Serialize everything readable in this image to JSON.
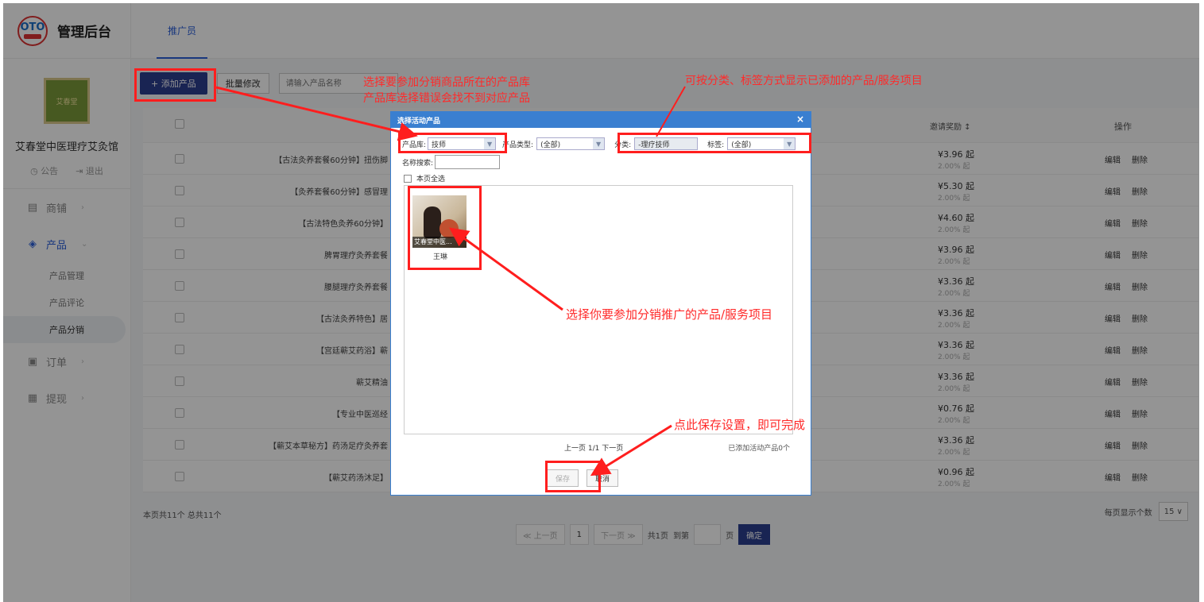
{
  "app": {
    "brand_badge": "OTO",
    "title": "管理后台"
  },
  "sidebar": {
    "shop_logo_text": "艾春堂",
    "shop_name": "艾春堂中医理疗艾灸馆",
    "links": [
      "公告",
      "退出"
    ],
    "nav": [
      {
        "label": "商铺",
        "icon": "shop-icon"
      },
      {
        "label": "产品",
        "icon": "layers-icon"
      },
      {
        "label": "订单",
        "icon": "order-icon"
      },
      {
        "label": "提现",
        "icon": "wallet-icon"
      }
    ],
    "sub": [
      "产品管理",
      "产品评论",
      "产品分销"
    ]
  },
  "tabs": [
    "推广员"
  ],
  "toolbar": {
    "add": "+ 添加产品",
    "batch": "批量修改",
    "search_placeholder": "请输入产品名称"
  },
  "table": {
    "headers": {
      "reward": "邀请奖励 ↕",
      "ops": "操作"
    },
    "rows": [
      {
        "name": "【古法灸养套餐60分钟】扭伤脚",
        "reward": "¥3.96 起",
        "pct": "2.00% 起"
      },
      {
        "name": "【灸养套餐60分钟】感冒理",
        "reward": "¥5.30 起",
        "pct": "2.00% 起"
      },
      {
        "name": "【古法特色灸养60分钟】",
        "reward": "¥4.60 起",
        "pct": "2.00% 起"
      },
      {
        "name": "脾胃理疗灸养套餐",
        "reward": "¥3.96 起",
        "pct": "2.00% 起"
      },
      {
        "name": "腰腿理疗灸养套餐",
        "reward": "¥3.36 起",
        "pct": "2.00% 起"
      },
      {
        "name": "【古法灸养特色】居",
        "reward": "¥3.36 起",
        "pct": "2.00% 起"
      },
      {
        "name": "【宫廷蕲艾药浴】蕲",
        "reward": "¥3.36 起",
        "pct": "2.00% 起"
      },
      {
        "name": "蕲艾精油",
        "reward": "¥3.36 起",
        "pct": "2.00% 起"
      },
      {
        "name": "【专业中医巡经",
        "reward": "¥0.76 起",
        "pct": "2.00% 起"
      },
      {
        "name": "【蕲艾本草秘方】药汤足疗灸养套",
        "reward": "¥3.36 起",
        "pct": "2.00% 起"
      },
      {
        "name": "【蕲艾药汤沐足】",
        "reward": "¥0.96 起",
        "pct": "2.00% 起"
      }
    ],
    "op_edit": "编辑",
    "op_delete": "删除"
  },
  "footer": {
    "summary": "本页共11个  总共11个",
    "per_page_label": "每页显示个数",
    "per_page": "15 ∨",
    "prev": "≪ 上一页",
    "page": "1",
    "next": "下一页 ≫",
    "total_pages": "共1页",
    "goto": "到第",
    "page_unit": "页",
    "ok": "确定"
  },
  "modal": {
    "title": "选择活动产品",
    "close": "×",
    "lib_label": "产品库:",
    "lib_value": "技师",
    "type_label": "产品类型:",
    "type_value": "(全部)",
    "cat_label": "分类:",
    "cat_value": "-理疗技师",
    "tag_label": "标签:",
    "tag_value": "(全部)",
    "name_search_label": "名称搜索:",
    "select_all": "本页全选",
    "card": {
      "caption": "艾春堂中医...",
      "name": "王琳"
    },
    "pager": "上一页 1/1 下一页",
    "added": "已添加活动产品0个",
    "save": "保存",
    "cancel": "取消"
  },
  "annotations": {
    "lib_line1": "选择要参加分销商品所在的产品库",
    "lib_line2": "产品库选择错误会找不到对应产品",
    "cat": "可按分类、标签方式显示已添加的产品/服务项目",
    "item": "选择你要参加分销推广的产品/服务项目",
    "save": "点此保存设置，即可完成"
  }
}
